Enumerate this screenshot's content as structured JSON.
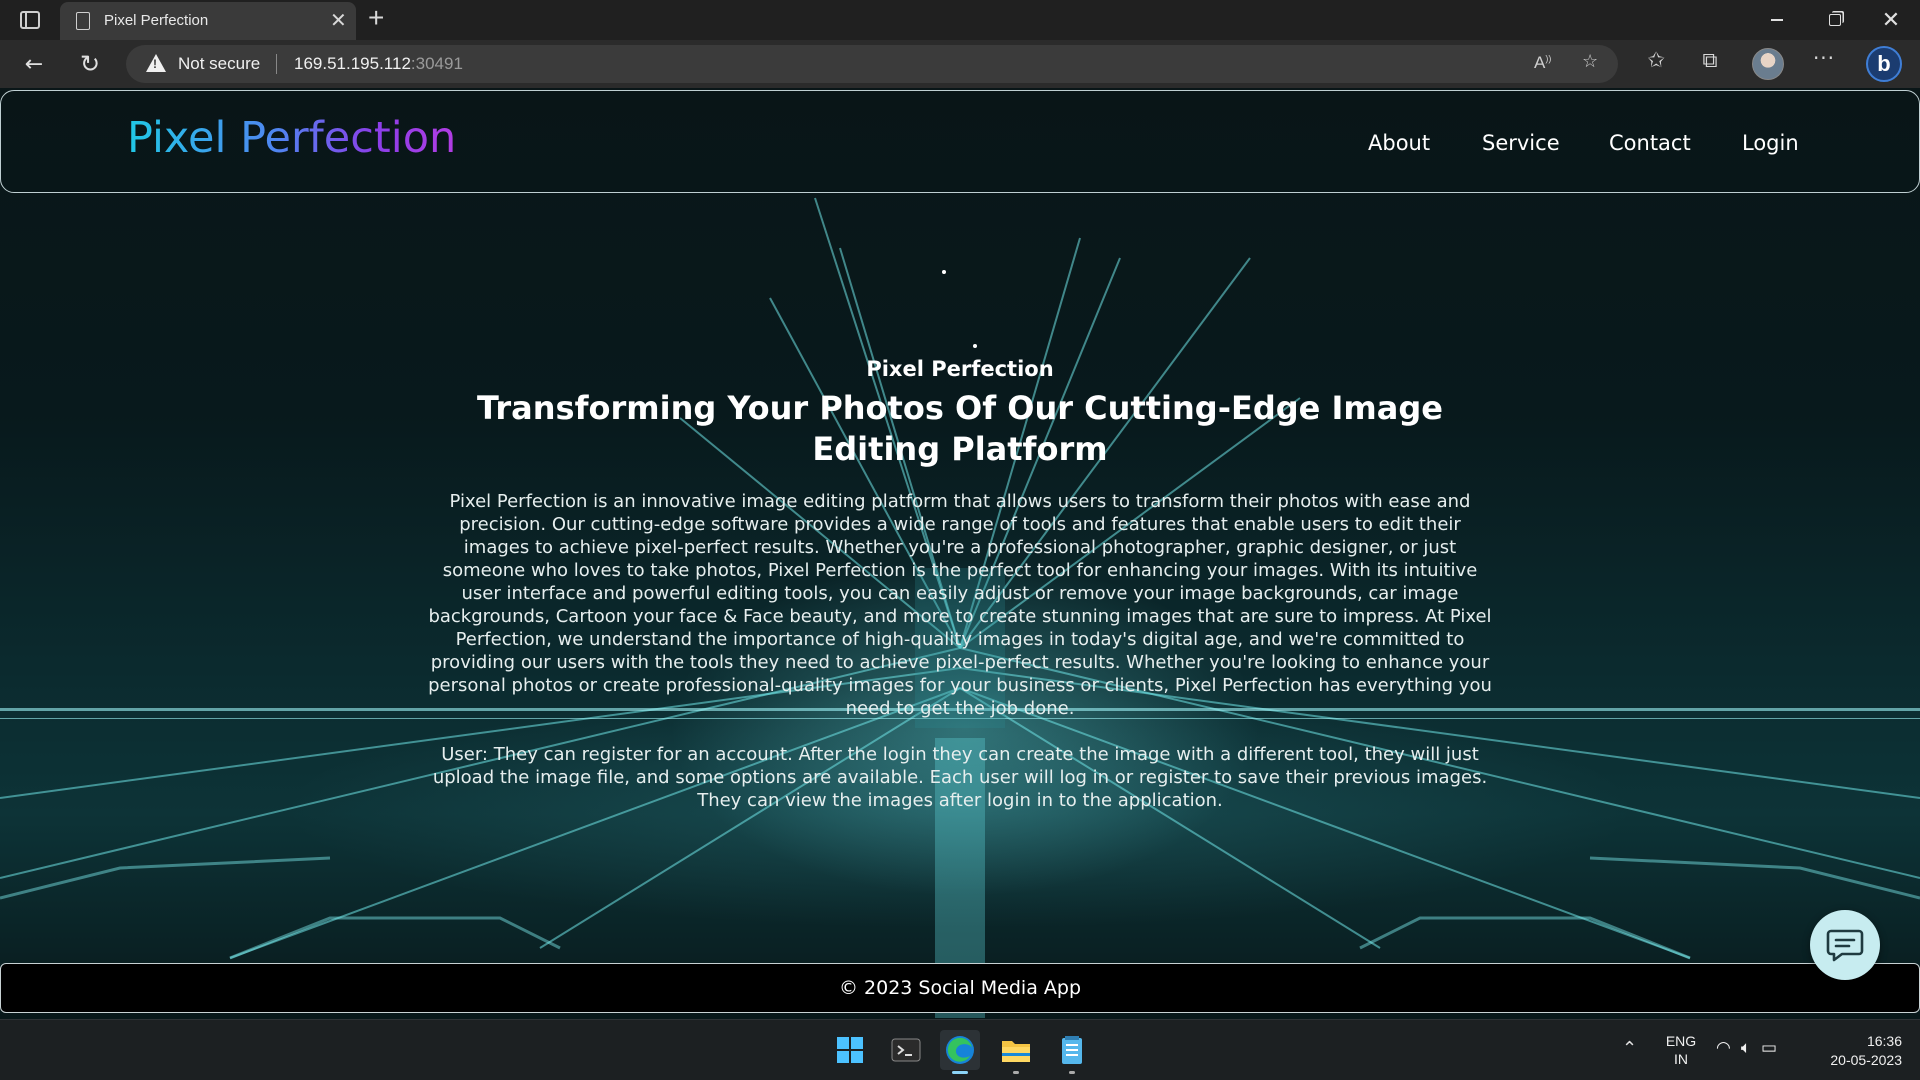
{
  "browser": {
    "tab_title": "Pixel Perfection",
    "tab_close": "✕",
    "new_tab": "+",
    "security_label": "Not secure",
    "url_host": "169.51.195.112",
    "url_port": ":30491",
    "icons": [
      "tab-actions-icon",
      "page-icon",
      "back-icon",
      "reload-icon",
      "warning-icon",
      "read-aloud-icon",
      "add-favorite-icon",
      "favorites-icon",
      "collections-icon",
      "profile-avatar",
      "more-icon",
      "bing-icon"
    ]
  },
  "site": {
    "brand": "Pixel Perfection",
    "brand_gradient": [
      "#20c8e6",
      "#4f86f0",
      "#8a3fe8",
      "#b23de3"
    ],
    "nav": {
      "about": "About",
      "service": "Service",
      "contact": "Contact",
      "login": "Login"
    },
    "hero": {
      "eyebrow": "Pixel Perfection",
      "title": "Transforming Your Photos Of Our Cutting-Edge Image Editing Platform",
      "paragraph_1": "Pixel Perfection is an innovative image editing platform that allows users to transform their photos with ease and precision. Our cutting-edge software provides a wide range of tools and features that enable users to edit their images to achieve pixel-perfect results. Whether you're a professional photographer, graphic designer, or just someone who loves to take photos, Pixel Perfection is the perfect tool for enhancing your images. With its intuitive user interface and powerful editing tools, you can easily adjust or remove your image backgrounds, car image backgrounds, Cartoon your face & Face beauty, and more to create stunning images that are sure to impress. At Pixel Perfection, we understand the importance of high-quality images in today's digital age, and we're committed to providing our users with the tools they need to achieve pixel-perfect results. Whether you're looking to enhance your personal photos or create professional-quality images for your business or clients, Pixel Perfection has everything you need to get the job done.",
      "paragraph_2": "User: They can register for an account. After the login they can create the image with a different tool, they will just upload the image file, and some options are available. Each user will log in or register to save their previous images. They can view the images after login in to the application."
    },
    "footer": "© 2023 Social Media App",
    "chat_button_icon": "chat-icon",
    "accent_color": "#c7ecf0"
  },
  "taskbar": {
    "apps": [
      "start-icon",
      "terminal-icon",
      "edge-icon",
      "file-explorer-icon",
      "notepad-icon"
    ],
    "lang_line1": "ENG",
    "lang_line2": "IN",
    "time": "16:36",
    "date": "20-05-2023"
  }
}
